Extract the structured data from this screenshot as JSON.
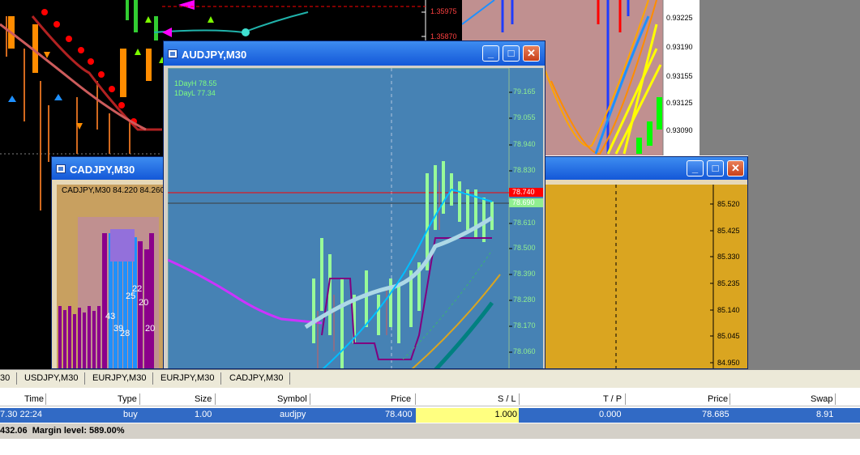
{
  "main_chart": {
    "price_labels": [
      "1.35975",
      "1.35870"
    ]
  },
  "right_chart": {
    "axis_prices": [
      "0.93225",
      "0.93190",
      "0.93155",
      "0.93125",
      "0.93090"
    ]
  },
  "audjpy": {
    "title": "AUDJPY,M30",
    "info_high": "1DayH 78.55",
    "info_low": "1DayL 77.34",
    "axis_prices": [
      "79.165",
      "79.055",
      "78.940",
      "78.830",
      "78.610",
      "78.500",
      "78.390",
      "78.280",
      "78.170",
      "78.060"
    ],
    "tag_red": "78.740",
    "tag_green": "78.690"
  },
  "cadjpy": {
    "title": "CADJPY,M30",
    "header_text": "CADJPY,M30  84.220 84.260",
    "axis_prices": [
      "85.520",
      "85.425",
      "85.330",
      "85.235",
      "85.140",
      "85.045",
      "84.950"
    ],
    "bar_numbers": [
      "22",
      "25",
      "20",
      "43",
      "39",
      "28",
      "20"
    ]
  },
  "tabs": [
    "30",
    "USDJPY,M30",
    "EURJPY,M30",
    "EURJPY,M30",
    "CADJPY,M30"
  ],
  "table": {
    "headers": [
      "Time",
      "Type",
      "Size",
      "Symbol",
      "Price",
      "S / L",
      "T / P",
      "Price",
      "Swap"
    ],
    "row": [
      "7.30 22:24",
      "buy",
      "1.00",
      "audjpy",
      "78.400",
      "1.000",
      "0.000",
      "78.685",
      "8.91"
    ],
    "status": "432.06  Margin level: 589.00%"
  },
  "colors": {
    "titlebar": "#2a6de0",
    "audjpy_bg": "#4682b4",
    "cadjpy_bg": "#daa520",
    "selected_row": "#316ac5",
    "sl_highlight": "#ffff80"
  }
}
